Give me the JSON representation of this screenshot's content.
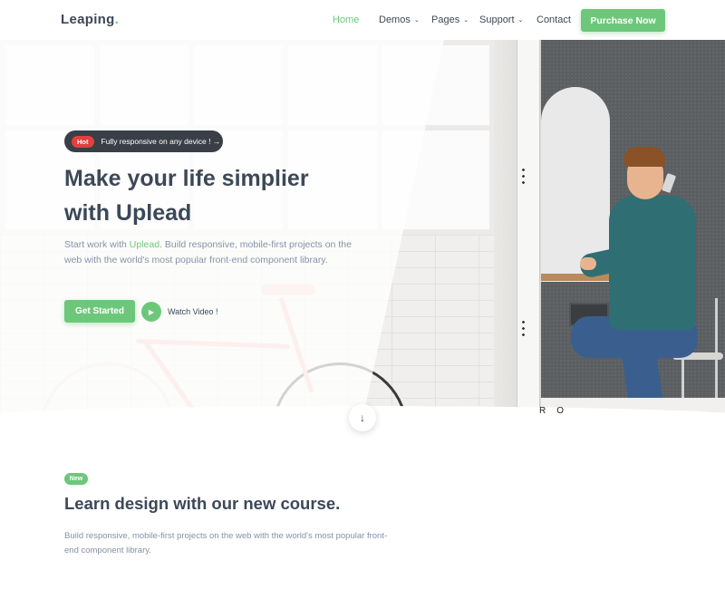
{
  "navbar": {
    "logo": "Leaping",
    "logo_dot": ".",
    "items": [
      {
        "label": "Home",
        "active": true,
        "has_dropdown": false
      },
      {
        "label": "Demos",
        "active": false,
        "has_dropdown": true
      },
      {
        "label": "Pages",
        "active": false,
        "has_dropdown": true
      },
      {
        "label": "Support",
        "active": false,
        "has_dropdown": true
      },
      {
        "label": "Contact",
        "active": false,
        "has_dropdown": false
      }
    ],
    "cta_label": "Purchase Now",
    "dropdown_icon": "chevron-down-icon"
  },
  "hero": {
    "badge_tag": "Hot",
    "badge_text": "Fully responsive on any device ! →",
    "title_line1": "Make your life simplier",
    "title_line2": "with Uplead",
    "desc_before": "Start work with ",
    "desc_accent": "Uplead",
    "desc_after": ". Build responsive, mobile-first projects on the web with the world's most popular front-end component library.",
    "primary_button": "Get Started",
    "video_label": "Watch Video !",
    "play_icon": "▶",
    "scroll_icon": "↓",
    "booth_letters": "RO"
  },
  "section": {
    "badge": "New",
    "title": "Learn design with our new course.",
    "desc": "Build responsive, mobile-first projects on the web with the world's most popular front-end component library."
  },
  "colors": {
    "accent": "#6dc77a",
    "heading": "#3c4858",
    "muted": "#8492a6",
    "hot": "#e43f3f",
    "badge_bg": "#3a3f47"
  }
}
